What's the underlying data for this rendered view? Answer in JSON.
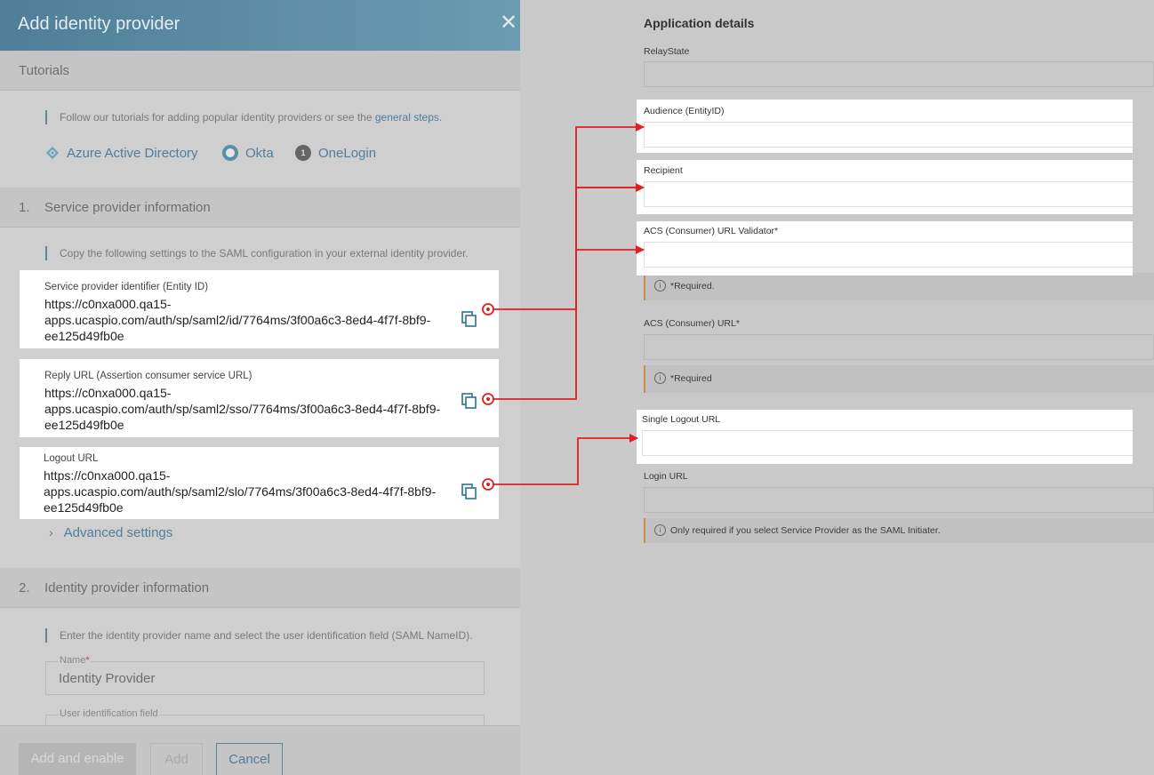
{
  "dialog": {
    "title": "Add identity provider",
    "close_icon": "close-icon",
    "tutorials": {
      "heading": "Tutorials",
      "hint_text": "Follow our tutorials for adding popular identity providers or see the ",
      "hint_link": "general steps",
      "hint_end": ".",
      "providers": [
        {
          "label": "Azure Active Directory",
          "icon": "azure-icon"
        },
        {
          "label": "Okta",
          "icon": "okta-icon"
        },
        {
          "label": "OneLogin",
          "icon": "onelogin-icon",
          "glyph": "1"
        }
      ]
    },
    "service_provider": {
      "number": "1.",
      "heading": "Service provider information",
      "hint": "Copy the following settings to the SAML configuration in your external identity provider.",
      "fields": [
        {
          "label": "Service provider identifier (Entity ID)",
          "value": "https://c0nxa000.qa15-apps.ucaspio.com/auth/sp/saml2/id/7764ms/3f00a6c3-8ed4-4f7f-8bf9-ee125d49fb0e"
        },
        {
          "label": "Reply URL (Assertion consumer service URL)",
          "value": "https://c0nxa000.qa15-apps.ucaspio.com/auth/sp/saml2/sso/7764ms/3f00a6c3-8ed4-4f7f-8bf9-ee125d49fb0e"
        },
        {
          "label": "Logout URL",
          "value": "https://c0nxa000.qa15-apps.ucaspio.com/auth/sp/saml2/slo/7764ms/3f00a6c3-8ed4-4f7f-8bf9-ee125d49fb0e"
        }
      ],
      "advanced": "Advanced settings"
    },
    "identity_provider": {
      "number": "2.",
      "heading": "Identity provider information",
      "hint": "Enter the identity provider name and select the user identification field (SAML NameID).",
      "name_label": "Name",
      "name_required": "*",
      "name_value": "Identity Provider",
      "user_field_label": "User identification field"
    },
    "footer": {
      "add_enable": "Add and enable",
      "add": "Add",
      "cancel": "Cancel"
    }
  },
  "app_details": {
    "title": "Application details",
    "relay_state_label": "RelayState",
    "audience_label": "Audience (EntityID)",
    "recipient_label": "Recipient",
    "acs_validator_label": "ACS (Consumer) URL Validator*",
    "acs_validator_note": "*Required.",
    "acs_url_label": "ACS (Consumer) URL*",
    "acs_url_note": "*Required",
    "single_logout_label": "Single Logout URL",
    "login_url_label": "Login URL",
    "login_url_note": "Only required if you select Service Provider as the SAML Initiater.",
    "info_glyph": "i"
  },
  "colors": {
    "header_blue": "#5b8ea9",
    "link_blue": "#4f7e9c",
    "arrow_red": "#e02020",
    "note_orange": "#c98d49"
  }
}
